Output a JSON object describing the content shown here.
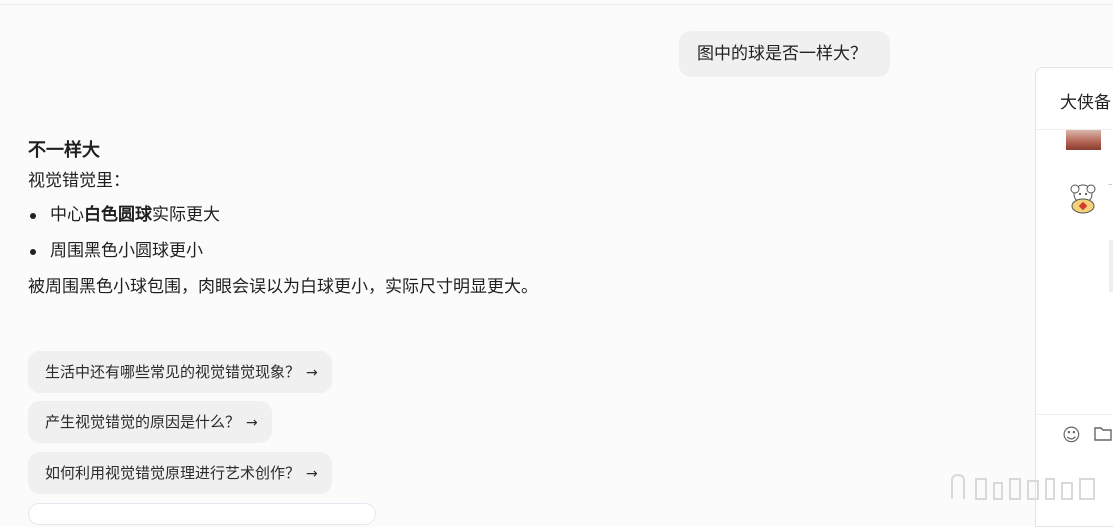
{
  "user_message": "图中的球是否一样大？",
  "answer": {
    "title": "不一样大",
    "subtitle": "视觉错觉里：",
    "bullets": [
      {
        "pre": "中心",
        "bold": "白色圆球",
        "post": "实际更大"
      },
      {
        "pre": "周围黑色小圆球更小",
        "bold": "",
        "post": ""
      }
    ],
    "paragraph": "被周围黑色小球包围，肉眼会误以为白球更小，实际尺寸明显更大。"
  },
  "suggestions": [
    {
      "label": "生活中还有哪些常见的视觉错觉现象？",
      "arrow": "→"
    },
    {
      "label": "产生视觉错觉的原因是什么？",
      "arrow": "→"
    },
    {
      "label": "如何利用视觉错觉原理进行艺术创作？",
      "arrow": "→"
    }
  ],
  "side_panel": {
    "title": "大侠备",
    "icons": {
      "emoji": "smiley-icon",
      "folder": "folder-icon"
    }
  }
}
